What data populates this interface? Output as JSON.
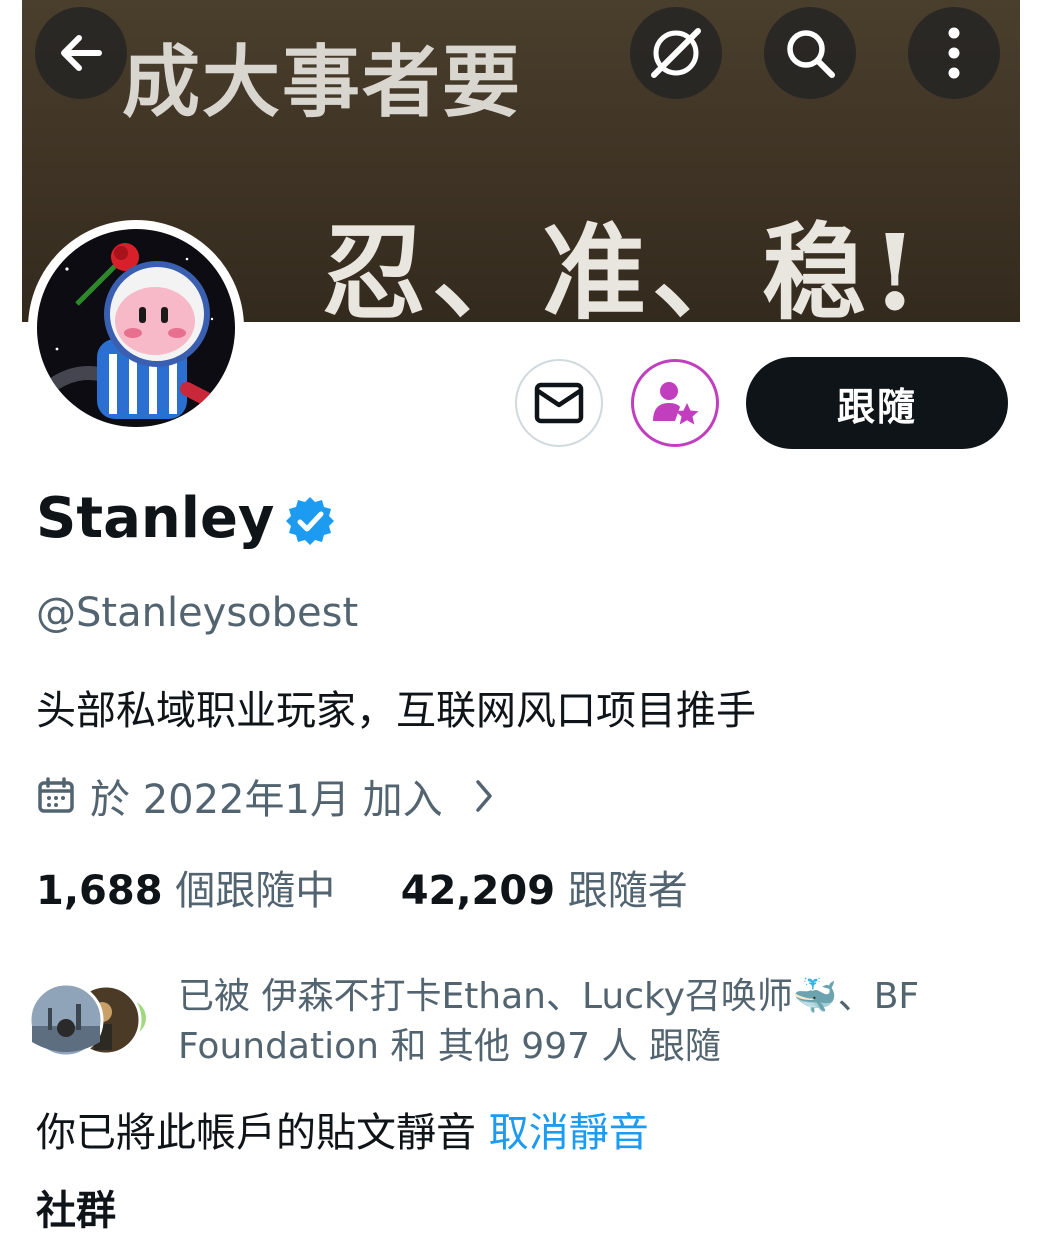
{
  "banner": {
    "line1": "成大事者要",
    "line2": "忍、准、稳!"
  },
  "nav": {
    "back_icon": "arrow-left-icon",
    "grok_icon": "slash-circle-icon",
    "search_icon": "search-icon",
    "more_icon": "vertical-ellipsis-icon"
  },
  "actions": {
    "message_icon": "envelope-icon",
    "subscribe_icon": "person-star-icon",
    "subscribe_color": "#c13ebf",
    "follow_label": "跟隨"
  },
  "profile": {
    "name": "Stanley",
    "verified_color": "#1d9bf0",
    "handle": "@Stanleysobest",
    "bio": "头部私域职业玩家，互联网风口项目推手",
    "joined": "於 2022年1月 加入",
    "following_count": "1,688",
    "following_label": "個跟隨中",
    "followers_count": "42,209",
    "followers_label": "跟隨者"
  },
  "followed_by": {
    "text": "已被 伊森不打卡Ethan、Lucky召唤师🐳、BF Foundation 和 其他 997 人 跟隨"
  },
  "muted": {
    "text": "你已將此帳戶的貼文靜音",
    "unmute_label": "取消靜音"
  },
  "next_section": {
    "label": "社群"
  }
}
